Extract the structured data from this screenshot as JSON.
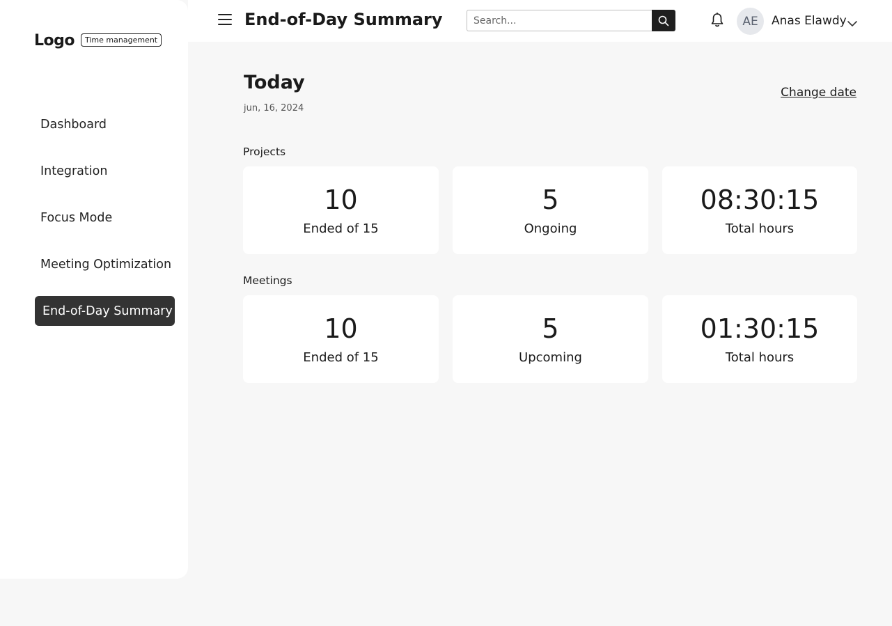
{
  "sidebar": {
    "logo": "Logo",
    "badge": "Time management",
    "items": [
      {
        "label": "Dashboard"
      },
      {
        "label": "Integration"
      },
      {
        "label": "Focus Mode"
      },
      {
        "label": "Meeting Optimization"
      },
      {
        "label": "End-of-Day Summary",
        "active": true
      }
    ]
  },
  "header": {
    "title": "End-of-Day Summary",
    "search_placeholder": "Search...",
    "avatar_initials": "AE",
    "user_name": "Anas Elawdy",
    "icons": [
      "menu-icon",
      "search-icon",
      "bell-icon",
      "chevron-down-icon"
    ]
  },
  "main": {
    "heading": "Today",
    "date": "jun, 16, 2024",
    "change_date": "Change date",
    "projects": {
      "label": "Projects",
      "cards": [
        {
          "value": "10",
          "label": "Ended of 15"
        },
        {
          "value": "5",
          "label": "Ongoing"
        },
        {
          "value": "08:30:15",
          "label": "Total hours"
        }
      ]
    },
    "meetings": {
      "label": "Meetings",
      "cards": [
        {
          "value": "10",
          "label": "Ended of 15"
        },
        {
          "value": "5",
          "label": "Upcoming"
        },
        {
          "value": "01:30:15",
          "label": "Total hours"
        }
      ]
    }
  },
  "colors": {
    "active_nav_bg": "#333333",
    "page_bg": "#f7f7f7",
    "card_bg": "#ffffff",
    "search_button_bg": "#1f1f1f"
  }
}
